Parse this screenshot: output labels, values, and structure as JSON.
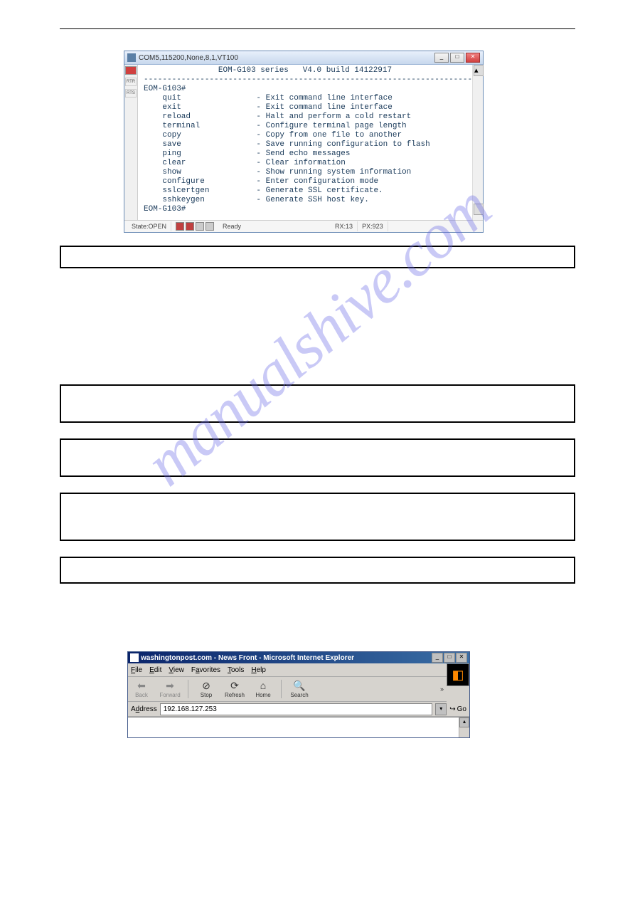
{
  "watermark": "manualshive.com",
  "terminal": {
    "title": "COM5,115200,None,8,1,VT100",
    "header_line": "EOM-G103 series   V4.0 build 14122917",
    "divider": "--------------------------------------------------------------------------",
    "prompt1": "EOM-G103#",
    "rows": [
      {
        "cmd": "quit",
        "desc": "- Exit command line interface"
      },
      {
        "cmd": "exit",
        "desc": "- Exit command line interface"
      },
      {
        "cmd": "reload",
        "desc": "- Halt and perform a cold restart"
      },
      {
        "cmd": "terminal",
        "desc": "- Configure terminal page length"
      },
      {
        "cmd": "copy",
        "desc": "- Copy from one file to another"
      },
      {
        "cmd": "save",
        "desc": "- Save running configuration to flash"
      },
      {
        "cmd": "ping",
        "desc": "- Send echo messages"
      },
      {
        "cmd": "clear",
        "desc": "- Clear information"
      },
      {
        "cmd": "show",
        "desc": "- Show running system information"
      },
      {
        "cmd": "configure",
        "desc": "- Enter configuration mode"
      },
      {
        "cmd": "sslcertgen",
        "desc": "- Generate SSL certificate."
      },
      {
        "cmd": "sshkeygen",
        "desc": "- Generate SSH host key."
      }
    ],
    "prompt2": "EOM-G103#",
    "side_labels": {
      "rtr": "RTR",
      "rts": "RTS"
    },
    "status": {
      "state": "State:OPEN",
      "ready": "Ready",
      "rx": "RX:13",
      "px": "PX:923"
    }
  },
  "ie": {
    "title": "washingtonpost.com - News Front - Microsoft Internet Explorer",
    "menus": {
      "file": "File",
      "edit": "Edit",
      "view": "View",
      "favorites": "Favorites",
      "tools": "Tools",
      "help": "Help"
    },
    "toolbar": {
      "back": "Back",
      "forward": "Forward",
      "stop": "Stop",
      "refresh": "Refresh",
      "home": "Home",
      "search": "Search"
    },
    "address_label": "Address",
    "address_value": "192.168.127.253",
    "go_label": "Go"
  }
}
